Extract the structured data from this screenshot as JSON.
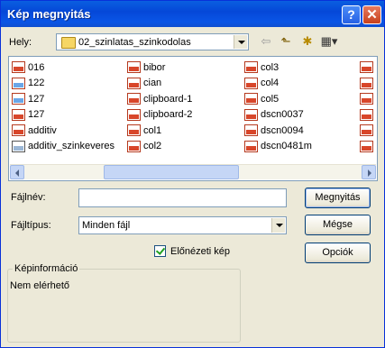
{
  "window": {
    "title": "Kép megnyitás"
  },
  "location": {
    "label": "Hely:",
    "value": "02_szinlatas_szinkodolas"
  },
  "toolbar_icons": [
    "back-arrow-icon",
    "up-folder-icon",
    "new-folder-icon",
    "view-menu-icon"
  ],
  "files": {
    "columns": [
      [
        {
          "name": "016",
          "icon": "image-file-icon"
        },
        {
          "name": "122",
          "icon": "image-file-icon"
        },
        {
          "name": "127",
          "icon": "image-file-icon"
        },
        {
          "name": "127",
          "icon": "image-file-icon"
        },
        {
          "name": "additiv",
          "icon": "image-file-icon"
        },
        {
          "name": "additiv_szinkeveres",
          "icon": "document-file-icon"
        }
      ],
      [
        {
          "name": "bibor",
          "icon": "image-file-icon"
        },
        {
          "name": "cian",
          "icon": "image-file-icon"
        },
        {
          "name": "clipboard-1",
          "icon": "image-file-icon"
        },
        {
          "name": "clipboard-2",
          "icon": "image-file-icon"
        },
        {
          "name": "col1",
          "icon": "image-file-icon"
        },
        {
          "name": "col2",
          "icon": "image-file-icon"
        }
      ],
      [
        {
          "name": "col3",
          "icon": "image-file-icon"
        },
        {
          "name": "col4",
          "icon": "image-file-icon"
        },
        {
          "name": "col5",
          "icon": "image-file-icon"
        },
        {
          "name": "dscn0037",
          "icon": "image-file-icon"
        },
        {
          "name": "dscn0094",
          "icon": "image-file-icon"
        },
        {
          "name": "dscn0481m",
          "icon": "image-file-icon"
        }
      ]
    ]
  },
  "filename": {
    "label": "Fájlnév:",
    "value": ""
  },
  "filetype": {
    "label": "Fájltípus:",
    "value": "Minden fájl"
  },
  "buttons": {
    "open": "Megnyitás",
    "cancel": "Mégse",
    "options": "Opciók"
  },
  "preview": {
    "label": "Előnézeti kép",
    "checked": true
  },
  "info": {
    "title": "Képinformáció",
    "text": "Nem elérhető"
  }
}
